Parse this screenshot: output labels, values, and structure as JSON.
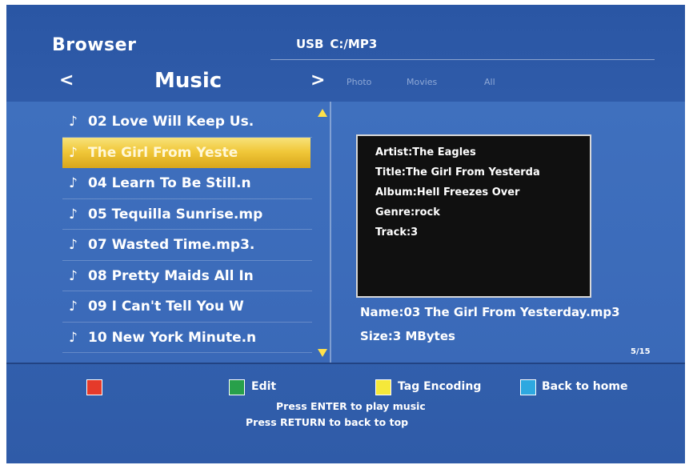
{
  "header": {
    "title": "Browser",
    "device": "USB",
    "path": "C:/MP3"
  },
  "nav": {
    "prev_symbol": "<",
    "category": "Music",
    "next_symbol": ">",
    "other_categories": [
      "Photo",
      "Movies",
      "All"
    ]
  },
  "file_list": {
    "note_glyph": "♪",
    "items": [
      "02 Love Will Keep Us.",
      "The Girl From Yeste",
      "04 Learn To Be Still.n",
      "05 Tequilla Sunrise.mp",
      "07 Wasted Time.mp3.",
      "08 Pretty Maids All In",
      "09 I Can't Tell You W",
      "10 New York Minute.n"
    ],
    "selected_index": 1
  },
  "info": {
    "artist": "Artist:The Eagles",
    "title": "Title:The Girl From Yesterda",
    "album": "Album:Hell Freezes Over",
    "genre": "Genre:rock",
    "track": "Track:3"
  },
  "details": {
    "name": "Name:03 The Girl From Yesterday.mp3",
    "size": "Size:3 MBytes",
    "page": "5/15"
  },
  "footer": {
    "keys": [
      {
        "color": "#e53a2a",
        "icon": "red-key-icon",
        "label": ""
      },
      {
        "color": "#28a04a",
        "icon": "green-key-icon",
        "label": "Edit"
      },
      {
        "color": "#f5e83a",
        "icon": "yellow-key-icon",
        "label": "Tag Encoding"
      },
      {
        "color": "#2ea8e0",
        "icon": "blue-key-icon",
        "label": "Back to home"
      }
    ],
    "hint_enter": "Press ENTER to play music",
    "hint_return": "Press RETURN to back to top"
  },
  "colors": {
    "background": "#2f5ba9",
    "selection": "#f1c83a",
    "scroll_arrow": "#ffe14a"
  }
}
